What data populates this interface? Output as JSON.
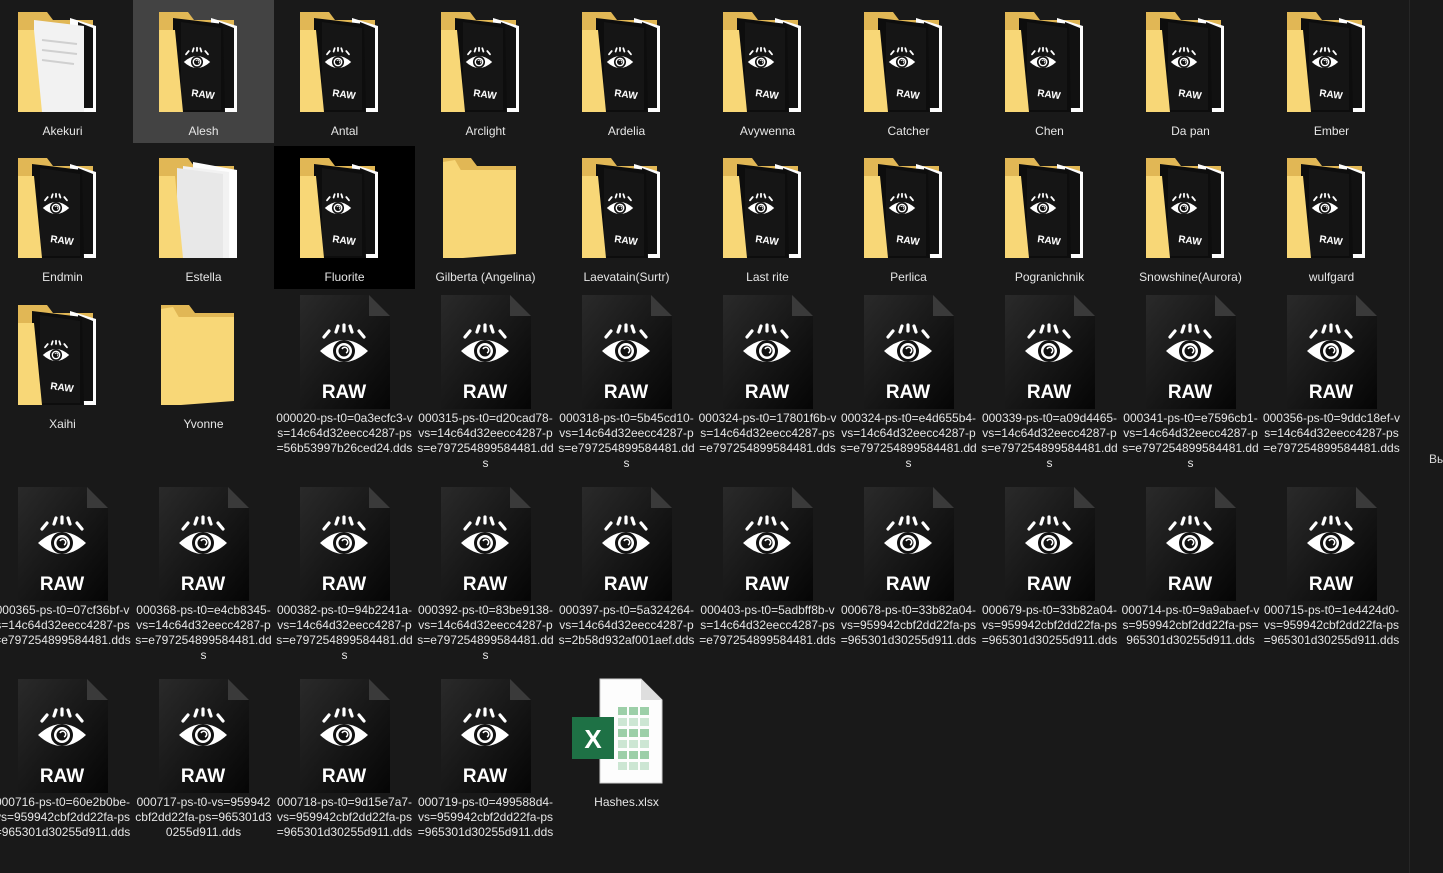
{
  "window": {
    "title": ""
  },
  "folders": [
    {
      "name": "Akekuri",
      "icon": "folder-document-icon",
      "state": "normal"
    },
    {
      "name": "Alesh",
      "icon": "folder-raw-icon",
      "state": "selected"
    },
    {
      "name": "Antal",
      "icon": "folder-raw-icon",
      "state": "normal"
    },
    {
      "name": "Arclight",
      "icon": "folder-raw-icon",
      "state": "normal"
    },
    {
      "name": "Ardelia",
      "icon": "folder-raw-icon",
      "state": "normal"
    },
    {
      "name": "Avywenna",
      "icon": "folder-raw-icon",
      "state": "normal"
    },
    {
      "name": "Catcher",
      "icon": "folder-raw-icon",
      "state": "normal"
    },
    {
      "name": "Chen",
      "icon": "folder-raw-icon",
      "state": "normal"
    },
    {
      "name": "Da pan",
      "icon": "folder-raw-icon",
      "state": "normal"
    },
    {
      "name": "Ember",
      "icon": "folder-raw-icon",
      "state": "normal"
    },
    {
      "name": "Endmin",
      "icon": "folder-raw-icon",
      "state": "normal"
    },
    {
      "name": "Estella",
      "icon": "folder-paper-icon",
      "state": "normal"
    },
    {
      "name": "Fluorite",
      "icon": "folder-raw-icon",
      "state": "hovered"
    },
    {
      "name": "Gilberta (Angelina)",
      "icon": "folder-empty-icon",
      "state": "normal"
    },
    {
      "name": "Laevatain(Surtr)",
      "icon": "folder-raw-icon",
      "state": "normal"
    },
    {
      "name": "Last rite",
      "icon": "folder-raw-icon",
      "state": "normal"
    },
    {
      "name": "Perlica",
      "icon": "folder-raw-icon",
      "state": "normal"
    },
    {
      "name": "Pogranichnik",
      "icon": "folder-raw-icon",
      "state": "normal"
    },
    {
      "name": "Snowshine(Aurora)",
      "icon": "folder-raw-icon",
      "state": "normal"
    },
    {
      "name": "wulfgard",
      "icon": "folder-raw-icon",
      "state": "normal"
    },
    {
      "name": "Xaihi",
      "icon": "folder-raw-icon",
      "state": "normal"
    },
    {
      "name": "Yvonne",
      "icon": "folder-empty-icon",
      "state": "normal"
    }
  ],
  "files": [
    {
      "name": "000020-ps-t0=0a3ecfc3-vs=14c64d32eecc4287-ps=56b53997b26ced24.dds",
      "icon": "raw-file-icon"
    },
    {
      "name": "000315-ps-t0=d20cad78-vs=14c64d32eecc4287-ps=e797254899584481.dds",
      "icon": "raw-file-icon"
    },
    {
      "name": "000318-ps-t0=5b45cd10-vs=14c64d32eecc4287-ps=e797254899584481.dds",
      "icon": "raw-file-icon"
    },
    {
      "name": "000324-ps-t0=17801f6b-vs=14c64d32eecc4287-ps=e797254899584481.dds",
      "icon": "raw-file-icon"
    },
    {
      "name": "000324-ps-t0=e4d655b4-vs=14c64d32eecc4287-ps=e797254899584481.dds",
      "icon": "raw-file-icon"
    },
    {
      "name": "000339-ps-t0=a09d4465-vs=14c64d32eecc4287-ps=e797254899584481.dds",
      "icon": "raw-file-icon"
    },
    {
      "name": "000341-ps-t0=e7596cb1-vs=14c64d32eecc4287-ps=e797254899584481.dds",
      "icon": "raw-file-icon"
    },
    {
      "name": "000356-ps-t0=9ddc18ef-vs=14c64d32eecc4287-ps=e797254899584481.dds",
      "icon": "raw-file-icon"
    },
    {
      "name": "000365-ps-t0=07cf36bf-vs=14c64d32eecc4287-ps=e797254899584481.dds",
      "icon": "raw-file-icon"
    },
    {
      "name": "000368-ps-t0=e4cb8345-vs=14c64d32eecc4287-ps=e797254899584481.dds",
      "icon": "raw-file-icon"
    },
    {
      "name": "000382-ps-t0=94b2241a-vs=14c64d32eecc4287-ps=e797254899584481.dds",
      "icon": "raw-file-icon"
    },
    {
      "name": "000392-ps-t0=83be9138-vs=14c64d32eecc4287-ps=e797254899584481.dds",
      "icon": "raw-file-icon"
    },
    {
      "name": "000397-ps-t0=5a324264-vs=14c64d32eecc4287-ps=2b58d932af001aef.dds",
      "icon": "raw-file-icon"
    },
    {
      "name": "000403-ps-t0=5adbff8b-vs=14c64d32eecc4287-ps=e797254899584481.dds",
      "icon": "raw-file-icon"
    },
    {
      "name": "000678-ps-t0=33b82a04-vs=959942cbf2dd22fa-ps=965301d30255d911.dds",
      "icon": "raw-file-icon"
    },
    {
      "name": "000679-ps-t0=33b82a04-vs=959942cbf2dd22fa-ps=965301d30255d911.dds",
      "icon": "raw-file-icon"
    },
    {
      "name": "000714-ps-t0=9a9abaef-vs=959942cbf2dd22fa-ps=965301d30255d911.dds",
      "icon": "raw-file-icon"
    },
    {
      "name": "000715-ps-t0=1e4424d0-vs=959942cbf2dd22fa-ps=965301d30255d911.dds",
      "icon": "raw-file-icon"
    },
    {
      "name": "000716-ps-t0=60e2b0be-vs=959942cbf2dd22fa-ps=965301d30255d911.dds",
      "icon": "raw-file-icon"
    },
    {
      "name": "000717-ps-t0-vs=959942cbf2dd22fa-ps=965301d30255d911.dds",
      "icon": "raw-file-icon"
    },
    {
      "name": "000718-ps-t0=9d15e7a7-vs=959942cbf2dd22fa-ps=965301d30255d911.dds",
      "icon": "raw-file-icon"
    },
    {
      "name": "000719-ps-t0=499588d4-vs=959942cbf2dd22fa-ps=965301d30255d911.dds",
      "icon": "raw-file-icon"
    },
    {
      "name": "Hashes.xlsx",
      "icon": "excel-file-icon"
    }
  ],
  "icon_labels": {
    "raw_badge": "RAW",
    "excel_badge": "X"
  },
  "right_edge_text": "Вы",
  "colors": {
    "background": "#191919",
    "selected": "#434343",
    "hovered": "#000000",
    "label": "#e6e6e6",
    "folder_front": "#f8d777",
    "folder_back": "#e1b755",
    "excel_green": "#1e7145"
  }
}
